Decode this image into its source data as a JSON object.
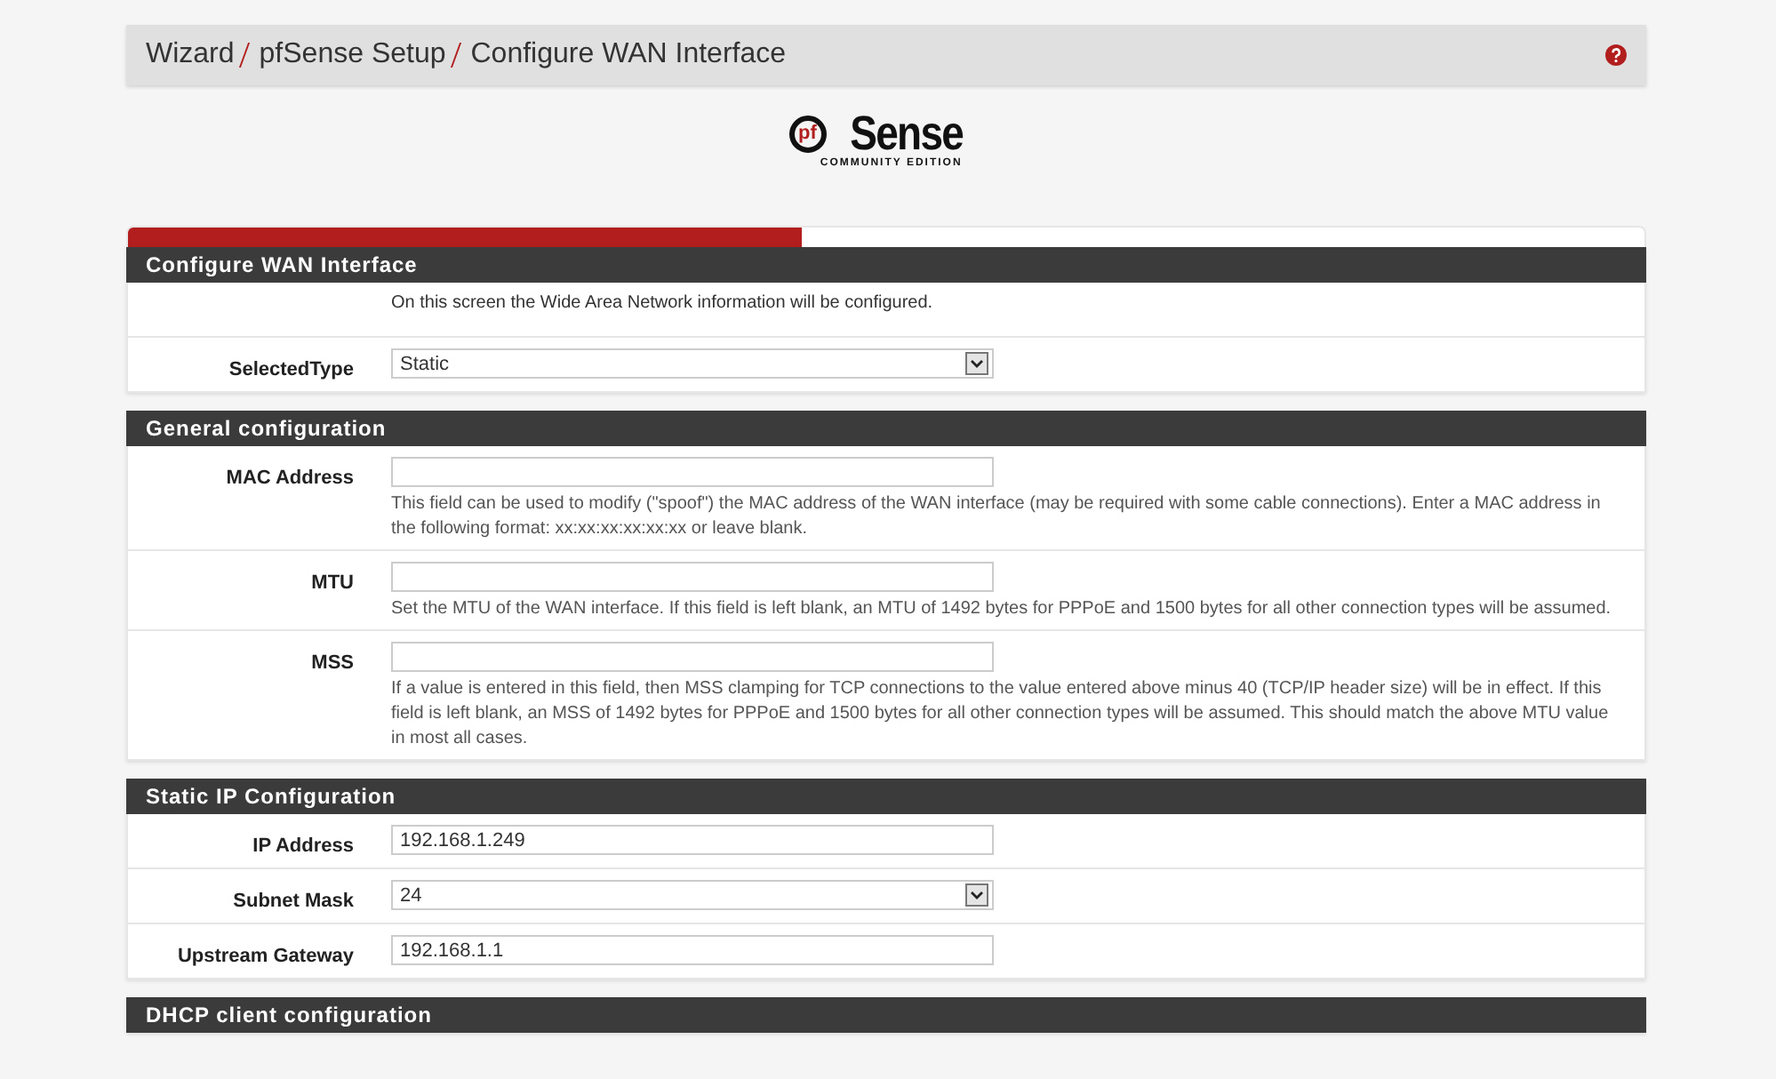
{
  "breadcrumb": [
    "Wizard",
    "pfSense Setup",
    "Configure WAN Interface"
  ],
  "logo": {
    "mark": "pf",
    "word": "Sense",
    "tagline": "COMMUNITY EDITION"
  },
  "progress": {
    "level": 0.444
  },
  "sections": [
    {
      "title": "Configure WAN Interface",
      "rows": [
        {
          "kind": "text",
          "label": "",
          "help": "On this screen the Wide Area Network information will be configured."
        },
        {
          "kind": "select",
          "label": "SelectedType",
          "value": "Static"
        }
      ]
    },
    {
      "title": "General configuration",
      "rows": [
        {
          "kind": "input",
          "label": "MAC Address",
          "value": "",
          "help": "This field can be used to modify (\"spoof\") the MAC address of the WAN interface (may be required with some cable connections). Enter a MAC address in the following format: xx:xx:xx:xx:xx:xx or leave blank."
        },
        {
          "kind": "input",
          "label": "MTU",
          "value": "",
          "help": "Set the MTU of the WAN interface. If this field is left blank, an MTU of 1492 bytes for PPPoE and 1500 bytes for all other connection types will be assumed."
        },
        {
          "kind": "input",
          "label": "MSS",
          "value": "",
          "help": "If a value is entered in this field, then MSS clamping for TCP connections to the value entered above minus 40 (TCP/IP header size) will be in effect. If this field is left blank, an MSS of 1492 bytes for PPPoE and 1500 bytes for all other connection types will be assumed. This should match the above MTU value in most all cases."
        }
      ]
    },
    {
      "title": "Static IP Configuration",
      "rows": [
        {
          "kind": "input",
          "label": "IP Address",
          "value": "192.168.1.249"
        },
        {
          "kind": "select",
          "label": "Subnet Mask",
          "value": "24"
        },
        {
          "kind": "input",
          "label": "Upstream Gateway",
          "value": "192.168.1.1"
        }
      ]
    },
    {
      "title": "DHCP client configuration"
    }
  ]
}
